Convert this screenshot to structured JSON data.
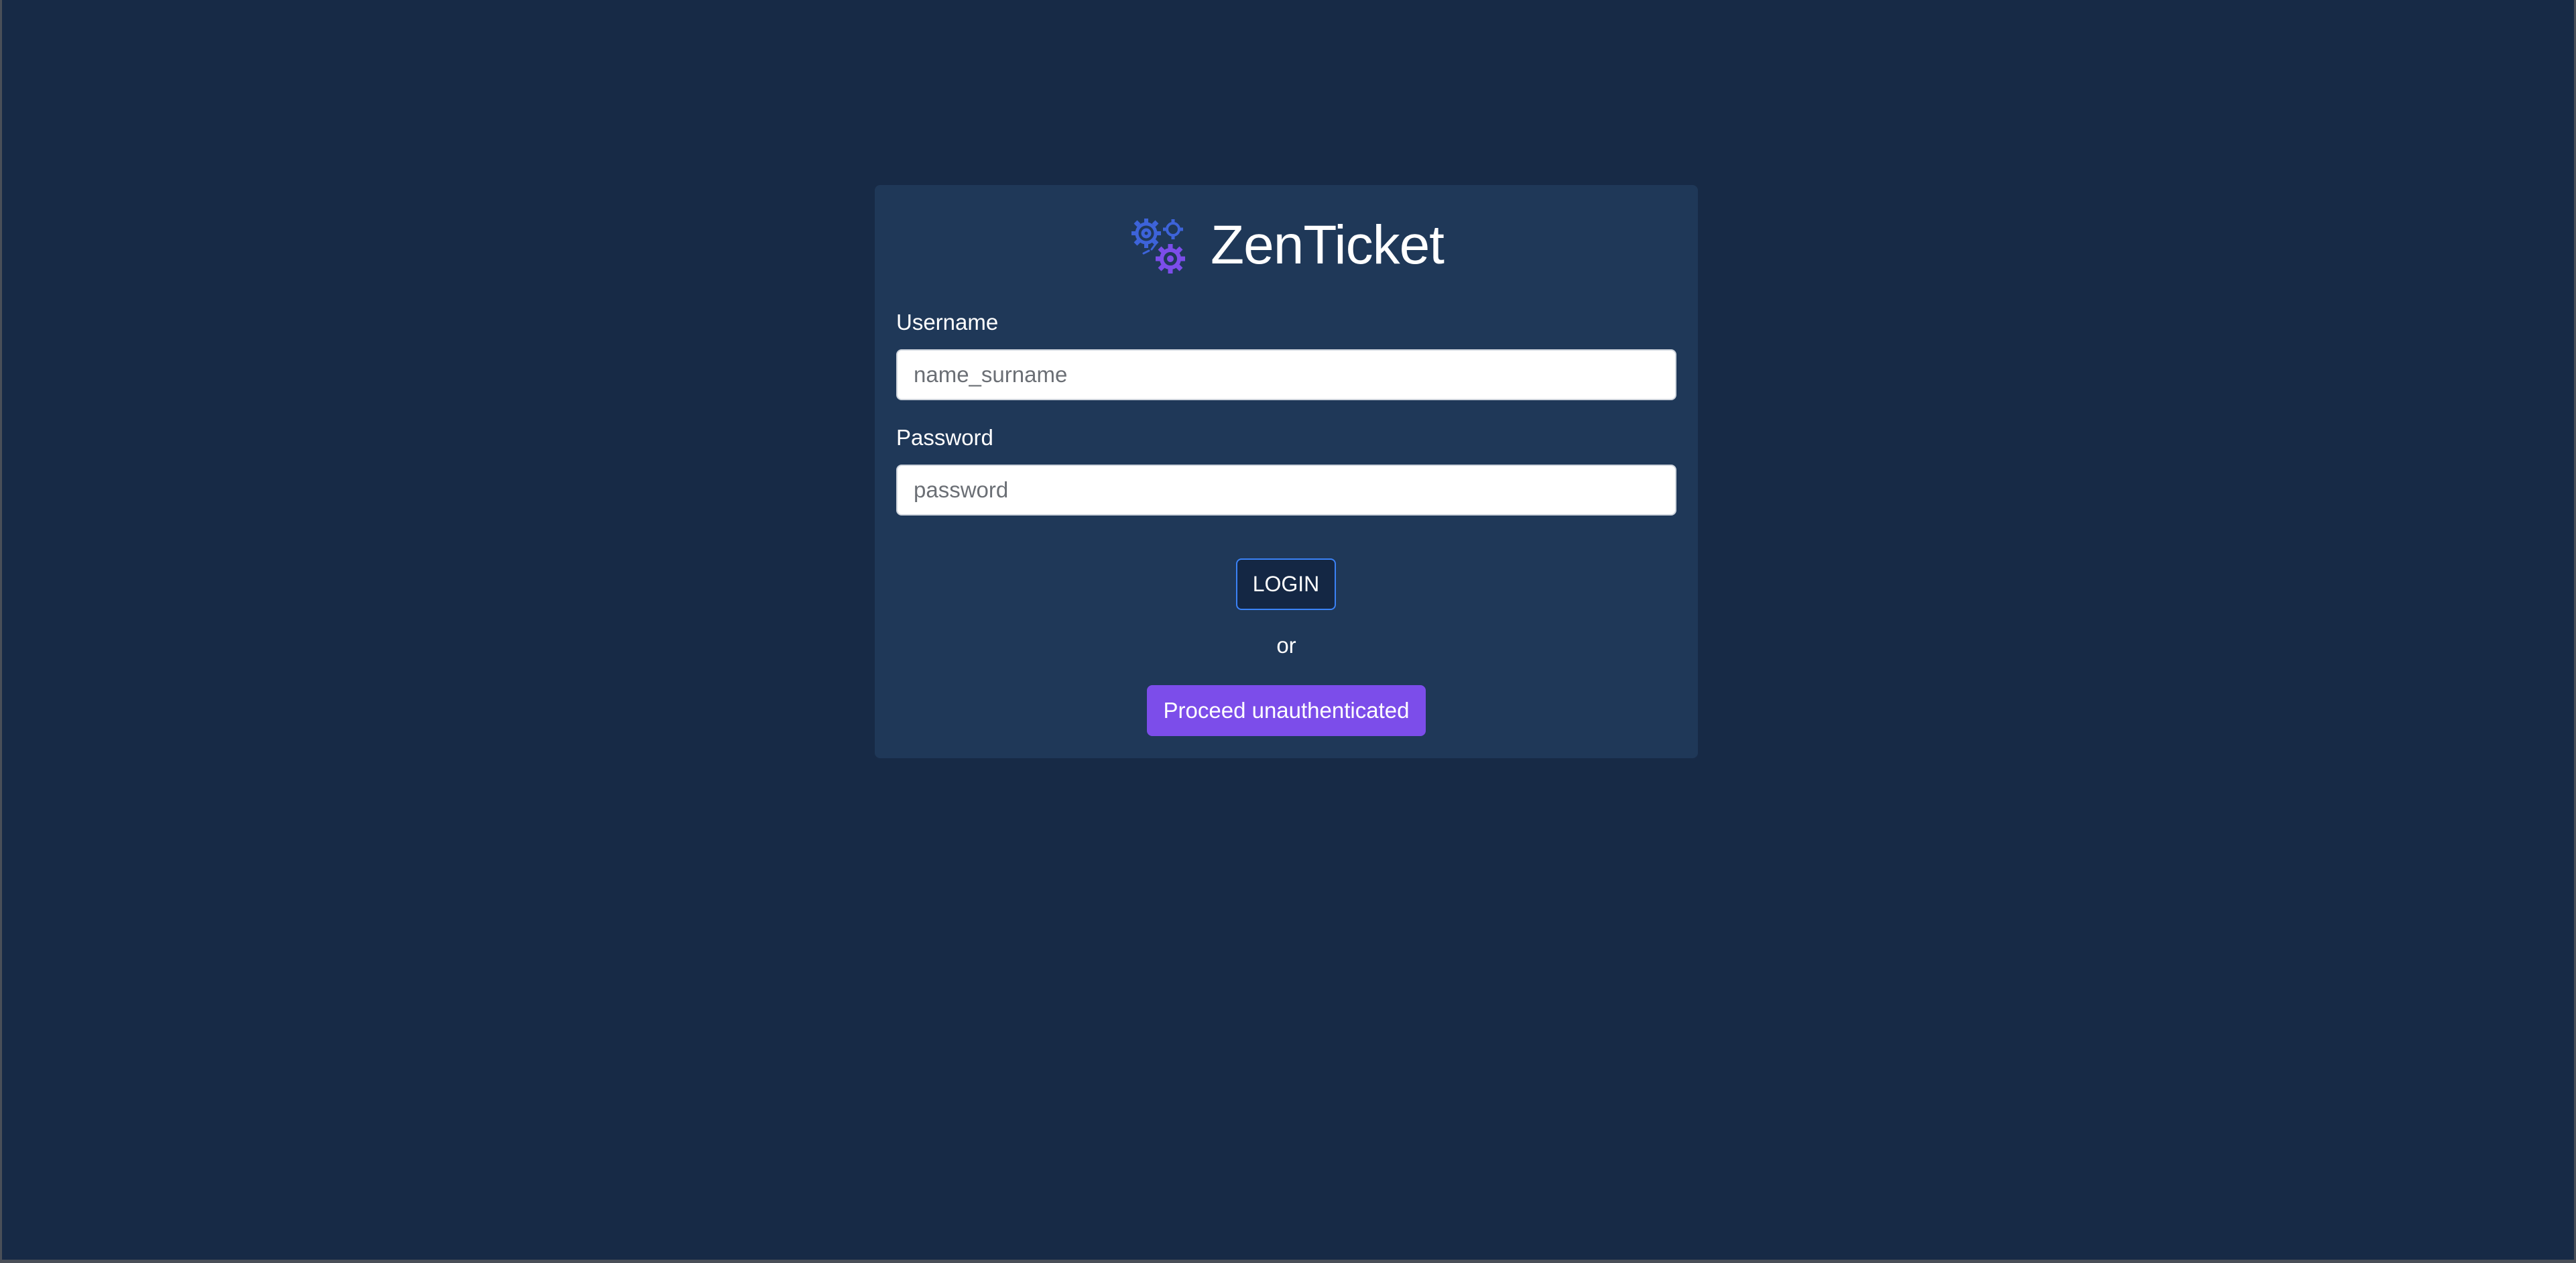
{
  "app": {
    "title": "ZenTicket",
    "logo_icon": "gears-icon"
  },
  "form": {
    "username": {
      "label": "Username",
      "placeholder": "name_surname",
      "value": ""
    },
    "password": {
      "label": "Password",
      "placeholder": "password",
      "value": ""
    },
    "login_label": "LOGIN",
    "separator": "or",
    "proceed_label": "Proceed unauthenticated"
  },
  "colors": {
    "background": "#172a46",
    "card": "#1f3858",
    "login_border": "#3b82f6",
    "proceed_button": "#7c4dea",
    "logo_blue": "#3d63d9",
    "logo_purple": "#7c4dea"
  }
}
